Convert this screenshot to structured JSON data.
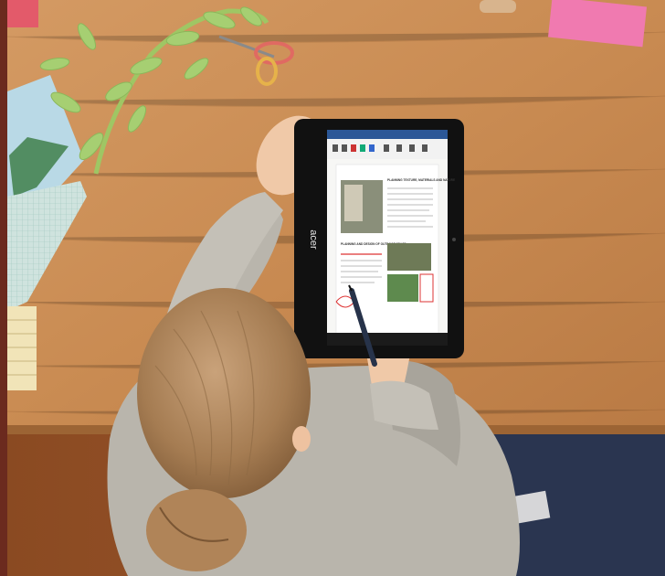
{
  "photo": {
    "device_brand": "acer",
    "document": {
      "heading_1": "PLANNING TEXTURE, MATERIALS AND NATURE",
      "heading_2": "PLANNING AND DESIGN OF OUTDOOR SPACE"
    }
  }
}
